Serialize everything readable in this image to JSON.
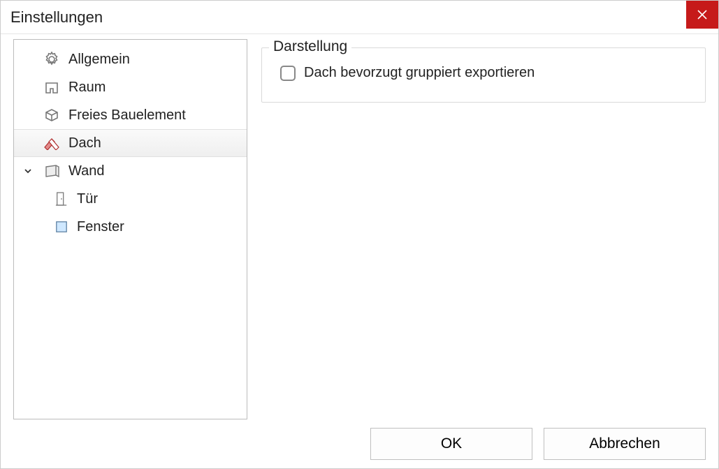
{
  "window": {
    "title": "Einstellungen"
  },
  "tree": {
    "items": [
      {
        "label": "Allgemein",
        "icon": "gear",
        "selected": false,
        "expandable": false
      },
      {
        "label": "Raum",
        "icon": "room",
        "selected": false,
        "expandable": false
      },
      {
        "label": "Freies Bauelement",
        "icon": "box3d",
        "selected": false,
        "expandable": false
      },
      {
        "label": "Dach",
        "icon": "roof",
        "selected": true,
        "expandable": false
      },
      {
        "label": "Wand",
        "icon": "wall",
        "selected": false,
        "expandable": true,
        "expanded": true
      }
    ],
    "children": [
      {
        "label": "Tür",
        "icon": "door"
      },
      {
        "label": "Fenster",
        "icon": "window"
      }
    ]
  },
  "group": {
    "title": "Darstellung",
    "checkbox_label": "Dach bevorzugt gruppiert exportieren",
    "checked": false
  },
  "buttons": {
    "ok": "OK",
    "cancel": "Abbrechen"
  }
}
